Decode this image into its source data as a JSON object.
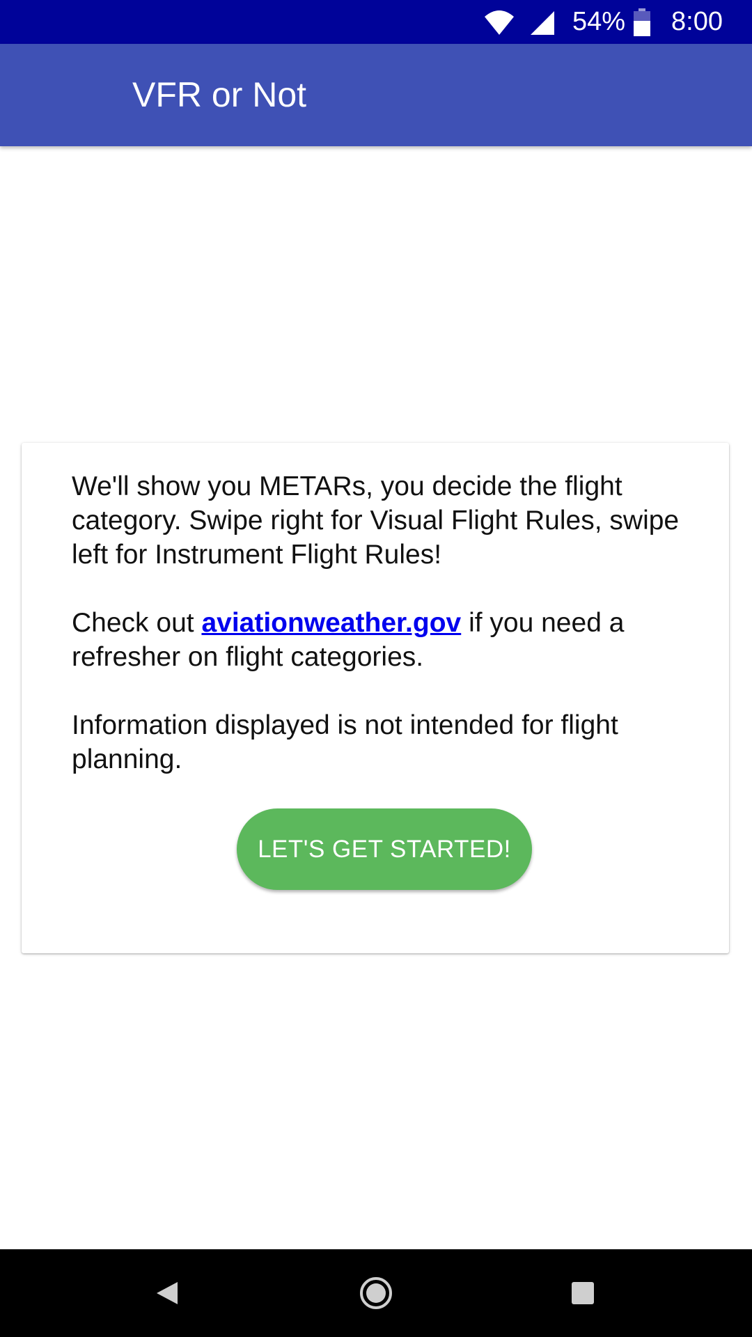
{
  "status_bar": {
    "battery_percent": "54%",
    "time": "8:00",
    "icons": [
      "wifi-icon",
      "signal-icon",
      "battery-icon"
    ]
  },
  "app_bar": {
    "title": "VFR or Not"
  },
  "card": {
    "paragraph1": "We'll show you METARs, you decide the flight category. Swipe right for Visual Flight Rules, swipe left for Instrument Flight Rules!",
    "paragraph2_prefix": "Check out ",
    "paragraph2_link": "aviationweather.gov",
    "paragraph2_suffix": " if you need a refresher on flight categories.",
    "paragraph3": "Information displayed is not intended for flight planning.",
    "button_label": "LET'S GET STARTED!"
  },
  "nav_bar": {
    "icons": [
      "back-icon",
      "home-icon",
      "recents-icon"
    ]
  },
  "colors": {
    "status_bar": "#000399",
    "app_bar": "#3f51b5",
    "button": "#5cb85c",
    "link": "#0000ee"
  }
}
